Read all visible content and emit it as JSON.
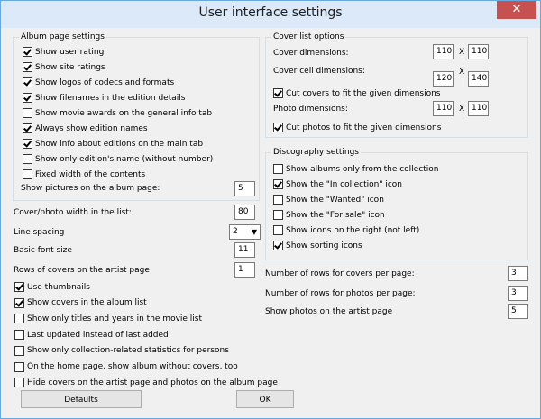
{
  "window": {
    "title": "User interface settings",
    "close": "✕"
  },
  "album_page": {
    "label": "Album page settings",
    "items": [
      {
        "text": "Show user rating",
        "checked": true
      },
      {
        "text": "Show site ratings",
        "checked": true
      },
      {
        "text": "Show logos of codecs and formats",
        "checked": true
      },
      {
        "text": "Show filenames in the edition details",
        "checked": true
      },
      {
        "text": "Show movie awards on the general info tab",
        "checked": false
      },
      {
        "text": "Always show edition names",
        "checked": true
      },
      {
        "text": "Show info about editions on the main tab",
        "checked": true
      },
      {
        "text": "Show only edition's name (without number)",
        "checked": false
      },
      {
        "text": "Fixed width of the contents",
        "checked": false
      }
    ],
    "pictures_label": "Show pictures on the album page:",
    "pictures_value": "5"
  },
  "left": {
    "cover_width_label": "Cover/photo width in the list:",
    "cover_width_value": "80",
    "line_spacing_label": "Line spacing",
    "line_spacing_value": "2",
    "font_size_label": "Basic font size",
    "font_size_value": "11",
    "rows_label": "Rows of covers on the artist page",
    "rows_value": "1",
    "items": [
      {
        "text": "Use thumbnails",
        "checked": true
      },
      {
        "text": "Show covers in the album list",
        "checked": true
      },
      {
        "text": "Show only titles and years in the movie list",
        "checked": false
      },
      {
        "text": "Last updated instead of last added",
        "checked": false
      },
      {
        "text": "Show only collection-related statistics for persons",
        "checked": false
      },
      {
        "text": "On the home page, show album without covers, too",
        "checked": false
      },
      {
        "text": "Hide covers on the artist page and photos on the album page",
        "checked": false
      }
    ]
  },
  "cover_list": {
    "label": "Cover list options",
    "cover_dim_label": "Cover dimensions:",
    "cover_w": "110",
    "cover_h": "110",
    "cell_dim_label": "Cover cell dimensions:",
    "cell_w": "120",
    "cell_h": "140",
    "cut_covers": {
      "text": "Cut covers to fit the given dimensions",
      "checked": true
    },
    "photo_dim_label": "Photo dimensions:",
    "photo_w": "110",
    "photo_h": "110",
    "cut_photos": {
      "text": "Cut photos to fit the given dimensions",
      "checked": true
    },
    "x": "X"
  },
  "discography": {
    "label": "Discography settings",
    "items": [
      {
        "text": "Show albums only from the collection",
        "checked": false
      },
      {
        "text": "Show the \"In collection\" icon",
        "checked": true
      },
      {
        "text": "Show the \"Wanted\" icon",
        "checked": false
      },
      {
        "text": "Show the \"For sale\" icon",
        "checked": false
      },
      {
        "text": "Show icons on the right (not left)",
        "checked": false
      },
      {
        "text": "Show sorting icons",
        "checked": true
      }
    ]
  },
  "right": {
    "rows_covers_label": "Number of rows for covers per page:",
    "rows_covers_value": "3",
    "rows_photos_label": "Number of rows for photos per page:",
    "rows_photos_value": "3",
    "photos_artist_label": "Show photos on the artist page",
    "photos_artist_value": "5"
  },
  "buttons": {
    "defaults": "Defaults",
    "ok": "OK"
  }
}
